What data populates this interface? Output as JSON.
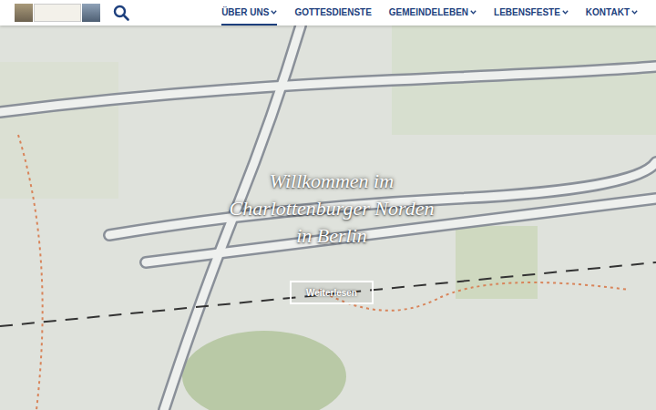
{
  "header": {
    "logo": {
      "panels": 3
    },
    "search": {
      "icon": "search"
    }
  },
  "nav": {
    "items": [
      {
        "label": "ÜBER UNS",
        "has_submenu": true,
        "selected": true
      },
      {
        "label": "GOTTESDIENSTE",
        "has_submenu": false,
        "selected": false
      },
      {
        "label": "GEMEINDELEBEN",
        "has_submenu": true,
        "selected": false
      },
      {
        "label": "LEBENSFESTE",
        "has_submenu": true,
        "selected": false
      },
      {
        "label": "KONTAKT",
        "has_submenu": true,
        "selected": false
      }
    ]
  },
  "hero": {
    "title_lines": [
      "Willkommen im",
      "Charlottenburger Norden",
      "in Berlin"
    ],
    "button": "Weiterlesen"
  }
}
